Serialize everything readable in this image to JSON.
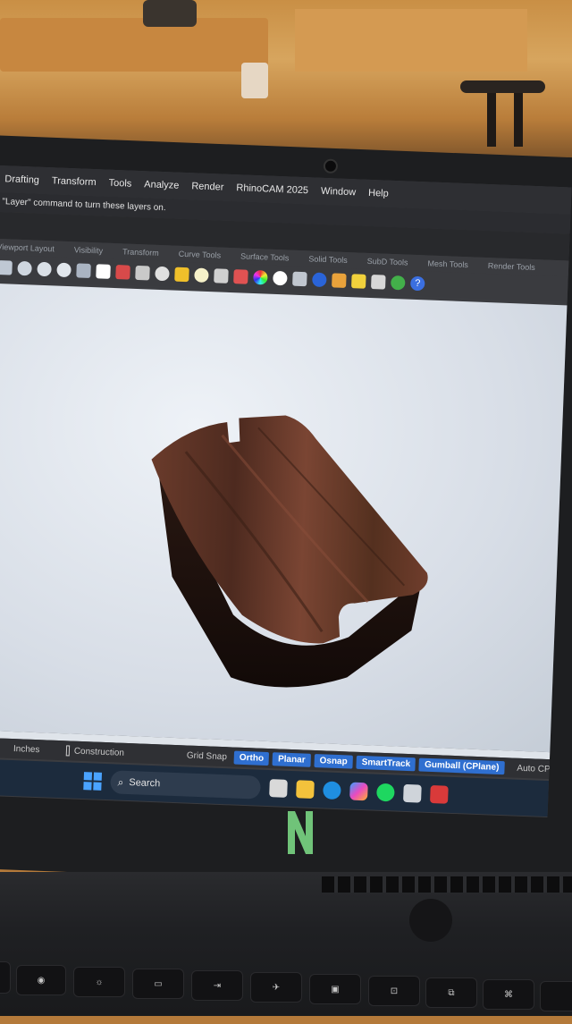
{
  "menu": {
    "items": [
      "Drafting",
      "Transform",
      "Tools",
      "Analyze",
      "Render",
      "RhinoCAM 2025",
      "Window",
      "Help"
    ]
  },
  "command_line": "\"Layer\" command to turn these layers on.",
  "toolbar_tabs": [
    "Viewport Layout",
    "Visibility",
    "Transform",
    "Curve Tools",
    "Surface Tools",
    "Solid Tools",
    "SubD Tools",
    "Mesh Tools",
    "Render Tools"
  ],
  "status": {
    "units": "Inches",
    "construction_label": "Construction",
    "grid_snap": "Grid Snap",
    "ortho": "Ortho",
    "planar": "Planar",
    "osnap": "Osnap",
    "smarttrack": "SmartTrack",
    "gumball": "Gumball (CPlane)",
    "auto_cplane": "Auto CPlane"
  },
  "taskbar": {
    "search_placeholder": "Search"
  },
  "colors": {
    "status_active": "#2f6fd0",
    "wood": "#5a3325",
    "viewport_bg": "#dfe4ea"
  }
}
